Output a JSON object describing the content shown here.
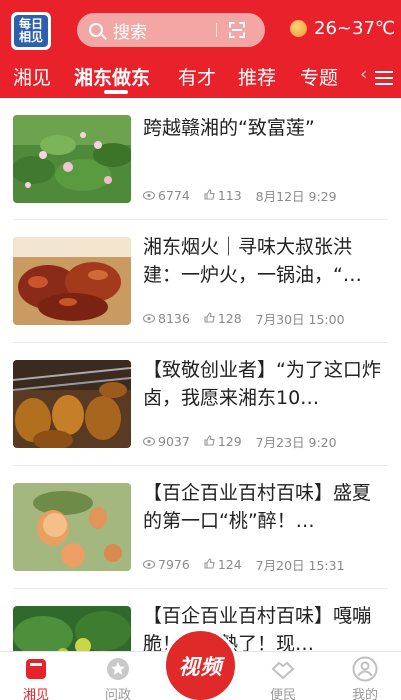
{
  "header": {
    "logo_text": "每日相见",
    "search_placeholder": "搜索",
    "weather": {
      "temperature": "26~37℃",
      "icon": "sun-icon"
    },
    "tabs": [
      {
        "label": "湘见",
        "active": false
      },
      {
        "label": "湘东做东",
        "active": true
      },
      {
        "label": "有才",
        "active": false
      },
      {
        "label": "推荐",
        "active": false
      },
      {
        "label": "专题",
        "active": false
      },
      {
        "label": "‹",
        "active": false
      }
    ],
    "accent": "#e8212b"
  },
  "articles": [
    {
      "title": "跨越赣湘的“致富莲”",
      "views": "6774",
      "likes": "113",
      "date": "8月12日 9:29"
    },
    {
      "title": "湘东烟火｜寻味大叔张洪建：一炉火，一锅油，“…",
      "views": "8136",
      "likes": "128",
      "date": "7月30日 15:00"
    },
    {
      "title": "【致敬创业者】“为了这口炸卤，我愿来湘东10…",
      "views": "9037",
      "likes": "129",
      "date": "7月23日 9:20"
    },
    {
      "title": "【百企百业百村百味】盛夏的第一口“桃”醉！…",
      "views": "7976",
      "likes": "124",
      "date": "7月20日 15:31"
    },
    {
      "title": "【百企百业百村百味】嘎嘣脆！李子熟了！现…",
      "views": "",
      "likes": "",
      "date": ""
    }
  ],
  "bottom_nav": [
    {
      "label": "湘见",
      "active": true,
      "icon": "news-icon"
    },
    {
      "label": "问政",
      "active": false,
      "icon": "star-badge-icon"
    },
    {
      "label": "视频",
      "active": false,
      "icon": "video-icon"
    },
    {
      "label": "便民",
      "active": false,
      "icon": "handshake-icon"
    },
    {
      "label": "我的",
      "active": false,
      "icon": "user-icon"
    }
  ]
}
